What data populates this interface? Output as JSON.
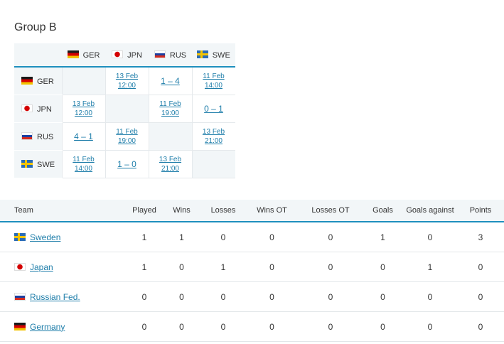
{
  "group_title": "Group B",
  "teams_order": [
    {
      "code": "GER",
      "flag": "flag-germany-icon"
    },
    {
      "code": "JPN",
      "flag": "flag-japan-icon"
    },
    {
      "code": "RUS",
      "flag": "flag-russia-icon"
    },
    {
      "code": "SWE",
      "flag": "flag-sweden-icon"
    }
  ],
  "matrix": {
    "GER": {
      "JPN": {
        "d": "13 Feb",
        "t": "12:00"
      },
      "RUS": {
        "score": "1 – 4"
      },
      "SWE": {
        "d": "11 Feb",
        "t": "14:00"
      }
    },
    "JPN": {
      "GER": {
        "d": "13 Feb",
        "t": "12:00"
      },
      "RUS": {
        "d": "11 Feb",
        "t": "19:00"
      },
      "SWE": {
        "score": "0 – 1"
      }
    },
    "RUS": {
      "GER": {
        "score": "4 – 1"
      },
      "JPN": {
        "d": "11 Feb",
        "t": "19:00"
      },
      "SWE": {
        "d": "13 Feb",
        "t": "21:00"
      }
    },
    "SWE": {
      "GER": {
        "d": "11 Feb",
        "t": "14:00"
      },
      "JPN": {
        "score": "1 – 0"
      },
      "RUS": {
        "d": "13 Feb",
        "t": "21:00"
      }
    }
  },
  "standings": {
    "headers": {
      "team": "Team",
      "played": "Played",
      "wins": "Wins",
      "losses": "Losses",
      "wins_ot": "Wins OT",
      "losses_ot": "Losses OT",
      "goals": "Goals",
      "goals_against": "Goals against",
      "points": "Points"
    },
    "rows": [
      {
        "team": "Sweden",
        "played": "1",
        "wins": "1",
        "losses": "0",
        "wins_ot": "0",
        "losses_ot": "0",
        "goals": "1",
        "goals_against": "0",
        "points": "3"
      },
      {
        "team": "Japan",
        "played": "1",
        "wins": "0",
        "losses": "1",
        "wins_ot": "0",
        "losses_ot": "0",
        "goals": "0",
        "goals_against": "1",
        "points": "0"
      },
      {
        "team": "Russian Fed.",
        "played": "0",
        "wins": "0",
        "losses": "0",
        "wins_ot": "0",
        "losses_ot": "0",
        "goals": "0",
        "goals_against": "0",
        "points": "0"
      },
      {
        "team": "Germany",
        "played": "0",
        "wins": "0",
        "losses": "0",
        "wins_ot": "0",
        "losses_ot": "0",
        "goals": "0",
        "goals_against": "0",
        "points": "0"
      }
    ]
  },
  "colors": {
    "accent": "#1e8fbe",
    "link": "#1f7eaa",
    "header_bg": "#f2f6f8"
  }
}
